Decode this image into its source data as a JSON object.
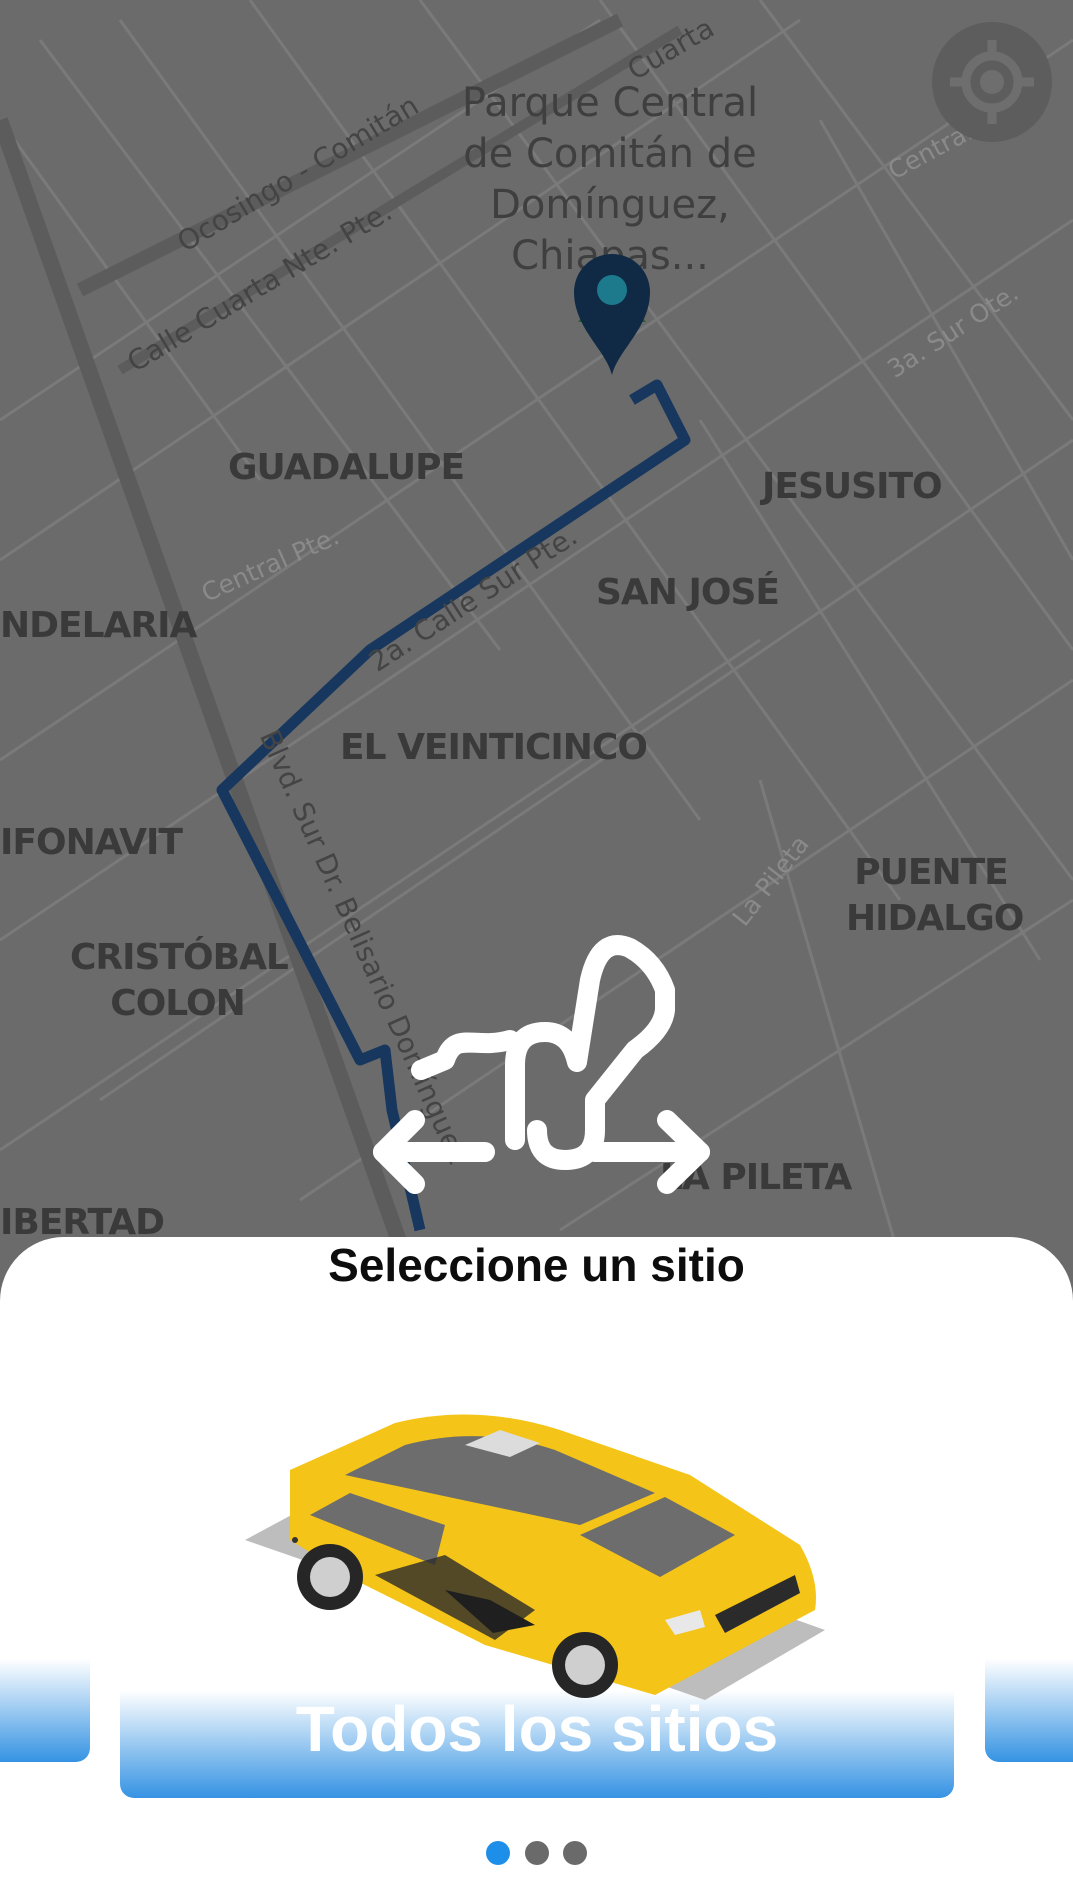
{
  "map": {
    "place_label": "Parque Central de Comitán de Domínguez, Chiapas...",
    "neighborhoods": {
      "guadalupe": "GUADALUPE",
      "jesusito": "JESUSITO",
      "candelaria": "NDELARIA",
      "san_jose": "SAN JOSÉ",
      "el_veinticinco": "EL VEINTICINCO",
      "infonavit": "IFONAVIT",
      "puente_hidalgo": "PUENTE HIDALGO",
      "cristobal_colon": "CRISTÓBAL COLON",
      "la_pileta": "LA PILETA",
      "libertad": "IBERTAD"
    },
    "streets": {
      "ocosingo": "Ocosingo - Comitán",
      "cuarta_nte": "Calle Cuarta Nte. Pte.",
      "cuarta_top": "Cuarta",
      "central_pte": "Central Pte.",
      "segunda_sur": "2a. Calle Sur Pte.",
      "bulevar": "Blvd. Sur Dr. Belisario Domínguez",
      "sur_ote": "3a. Sur Ote.",
      "central_ote": "Central Ote.",
      "la_pileta": "La Pileta"
    },
    "colors": {
      "route": "#17375e",
      "background": "#6b6b6b"
    }
  },
  "icons": {
    "locate": "crosshair-icon",
    "pin": "map-pin-icon",
    "gesture": "swipe-gesture-icon",
    "taxi": "taxi-car-icon"
  },
  "sheet": {
    "title": "Seleccione un sitio",
    "card_label": "Todos los sitios",
    "pagination_total": 3,
    "pagination_active": 1
  },
  "colors": {
    "accent": "#1e8fe8",
    "card_gradient": "#3593e3"
  }
}
